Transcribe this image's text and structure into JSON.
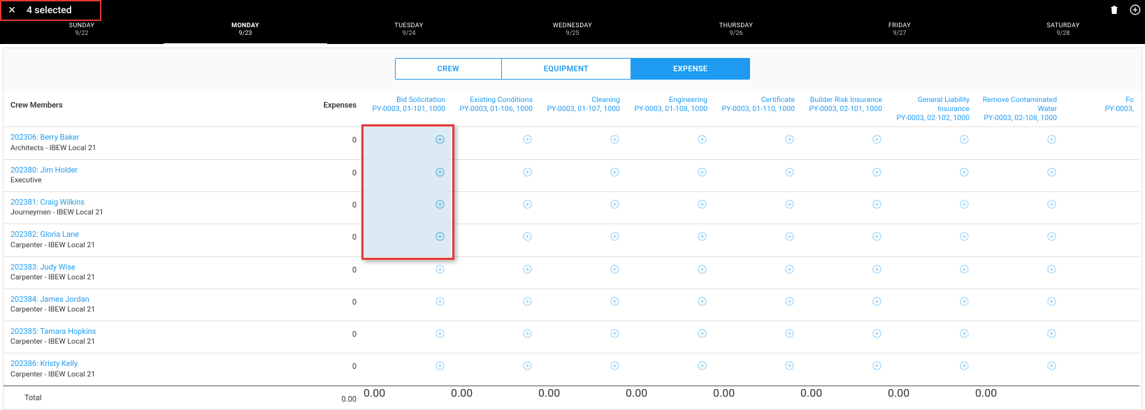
{
  "selection": {
    "label": "4 selected"
  },
  "days": [
    {
      "name": "SUNDAY",
      "date": "9/22"
    },
    {
      "name": "MONDAY",
      "date": "9/23",
      "active": true
    },
    {
      "name": "TUESDAY",
      "date": "9/24"
    },
    {
      "name": "WEDNESDAY",
      "date": "9/25"
    },
    {
      "name": "THURSDAY",
      "date": "9/26"
    },
    {
      "name": "FRIDAY",
      "date": "9/27"
    },
    {
      "name": "SATURDAY",
      "date": "9/28"
    }
  ],
  "segments": {
    "crew": "CREW",
    "equipment": "EQUIPMENT",
    "expense": "EXPENSE"
  },
  "headers": {
    "crewMembers": "Crew Members",
    "expenses": "Expenses",
    "cols": [
      {
        "title": "Bid Solicitation",
        "code": "PY-0003, 01-101, 1000",
        "selected": true
      },
      {
        "title": "Existing Conditions",
        "code": "PY-0003, 01-106, 1000"
      },
      {
        "title": "Cleaning",
        "code": "PY-0003, 01-107, 1000"
      },
      {
        "title": "Engineering",
        "code": "PY-0003, 01-108, 1000"
      },
      {
        "title": "Certificate",
        "code": "PY-0003, 01-110, 1000"
      },
      {
        "title": "Builder Risk Insurance",
        "code": "PY-0003, 02-101, 1000"
      },
      {
        "title": "General Liability Insurance",
        "code": "PY-0003, 02-102, 1000"
      },
      {
        "title": "Remove Contaminated Water",
        "code": "PY-0003, 02-108, 1000"
      },
      {
        "title": "Fo",
        "code": "PY-0003,"
      }
    ]
  },
  "rows": [
    {
      "name": "202306: Berry Baker",
      "sub": "Architects - IBEW Local 21",
      "exp": "0",
      "sel": true
    },
    {
      "name": "202380: Jim Holder",
      "sub": "Executive",
      "exp": "0",
      "sel": true
    },
    {
      "name": "202381: Craig Wilkins",
      "sub": "Journeymen - IBEW Local 21",
      "exp": "0",
      "sel": true
    },
    {
      "name": "202382: Gloria Lane",
      "sub": "Carpenter - IBEW Local 21",
      "exp": "0",
      "sel": true
    },
    {
      "name": "202383: Judy Wise",
      "sub": "Carpenter - IBEW Local 21",
      "exp": "0"
    },
    {
      "name": "202384: James Jordan",
      "sub": "Carpenter - IBEW Local 21",
      "exp": "0"
    },
    {
      "name": "202385: Tamara Hopkins",
      "sub": "Carpenter - IBEW Local 21",
      "exp": "0"
    },
    {
      "name": "202386: Kristy Kelly",
      "sub": "Carpenter - IBEW Local 21",
      "exp": "0"
    }
  ],
  "totals": {
    "label": "Total",
    "expenses": "0.00",
    "cols": [
      "0.00",
      "0.00",
      "0.00",
      "0.00",
      "0.00",
      "0.00",
      "0.00",
      "0.00",
      ""
    ]
  }
}
